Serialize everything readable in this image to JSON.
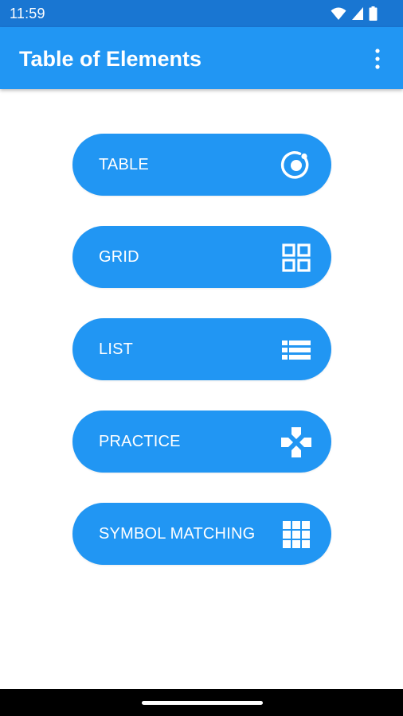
{
  "status_bar": {
    "time": "11:59",
    "icons": [
      "wifi-icon",
      "cell-signal-icon",
      "battery-icon"
    ]
  },
  "app_bar": {
    "title": "Table of Elements",
    "menu_icon": "more-vert-icon"
  },
  "menu": {
    "items": [
      {
        "label": "TABLE",
        "icon": "atom-ring-icon"
      },
      {
        "label": "GRID",
        "icon": "grid-icon"
      },
      {
        "label": "LIST",
        "icon": "list-icon"
      },
      {
        "label": "PRACTICE",
        "icon": "gamepad-icon"
      },
      {
        "label": "SYMBOL MATCHING",
        "icon": "apps-grid-icon"
      }
    ]
  },
  "colors": {
    "status_bar": "#1976d2",
    "app_bar": "#2196f3",
    "button": "#2196f3",
    "text_on_primary": "#ffffff",
    "nav_bar": "#000000"
  }
}
